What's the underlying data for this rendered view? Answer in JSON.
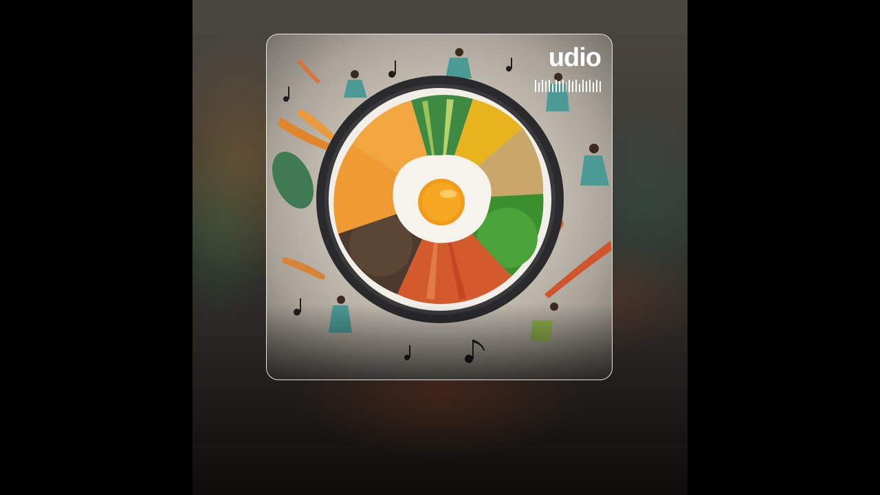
{
  "player": {
    "brand": "udio",
    "waveform": [
      18,
      14,
      18,
      16,
      18,
      12,
      18,
      16,
      18,
      14,
      18,
      16,
      18,
      12,
      18,
      16,
      18,
      14,
      18,
      16
    ],
    "colors": {
      "background_top": "#4a4742",
      "background_bottom": "#0d0c0b",
      "cover_border": "#e9e6e0",
      "brand_text": "#ffffff"
    }
  }
}
